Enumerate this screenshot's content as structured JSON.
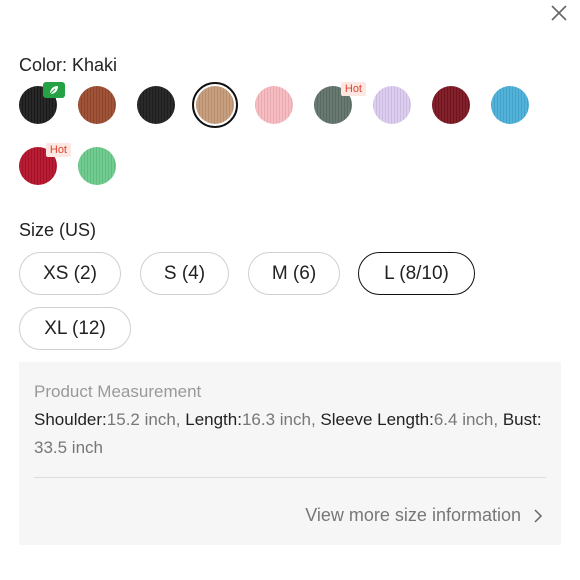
{
  "color_section": {
    "label": "Color: Khaki",
    "swatches": [
      {
        "name": "black-eco",
        "color": "#1c1c1c",
        "badge": "eco"
      },
      {
        "name": "brown",
        "color": "#9a4a2e"
      },
      {
        "name": "black",
        "color": "#1f1f1f"
      },
      {
        "name": "khaki",
        "color": "#c49a78",
        "selected": true
      },
      {
        "name": "pink",
        "color": "#f7b9bf"
      },
      {
        "name": "dark-green",
        "color": "#5f7268",
        "badge": "Hot"
      },
      {
        "name": "lilac",
        "color": "#dacaf0"
      },
      {
        "name": "burgundy",
        "color": "#7a1520"
      },
      {
        "name": "sky-blue",
        "color": "#4aaed8"
      },
      {
        "name": "red",
        "color": "#b3122a",
        "badge": "Hot"
      },
      {
        "name": "mint-green",
        "color": "#69c98a"
      }
    ],
    "hot_label": "Hot"
  },
  "size_section": {
    "label": "Size (US)",
    "sizes": [
      {
        "label": "XS (2)"
      },
      {
        "label": "S (4)"
      },
      {
        "label": "M (6)"
      },
      {
        "label": "L (8/10)",
        "selected": true
      },
      {
        "label": "XL (12)"
      }
    ]
  },
  "measurement": {
    "title": "Product Measurement",
    "items": [
      {
        "key": "Shoulder:",
        "value": "15.2 inch"
      },
      {
        "key": "Length:",
        "value": "16.3 inch"
      },
      {
        "key": "Sleeve Length:",
        "value": "6.4 inch"
      },
      {
        "key": "Bust:",
        "value": "33.5 inch"
      }
    ],
    "separator": ",  ",
    "more_link": "View more size information"
  },
  "icons": {
    "close": "close-icon",
    "chevron": "chevron-right-icon",
    "eco": "leaf-icon"
  },
  "accent": {
    "hot_text": "#e0442d",
    "hot_bg": "#fde7e2",
    "eco_bg": "#25a244"
  }
}
